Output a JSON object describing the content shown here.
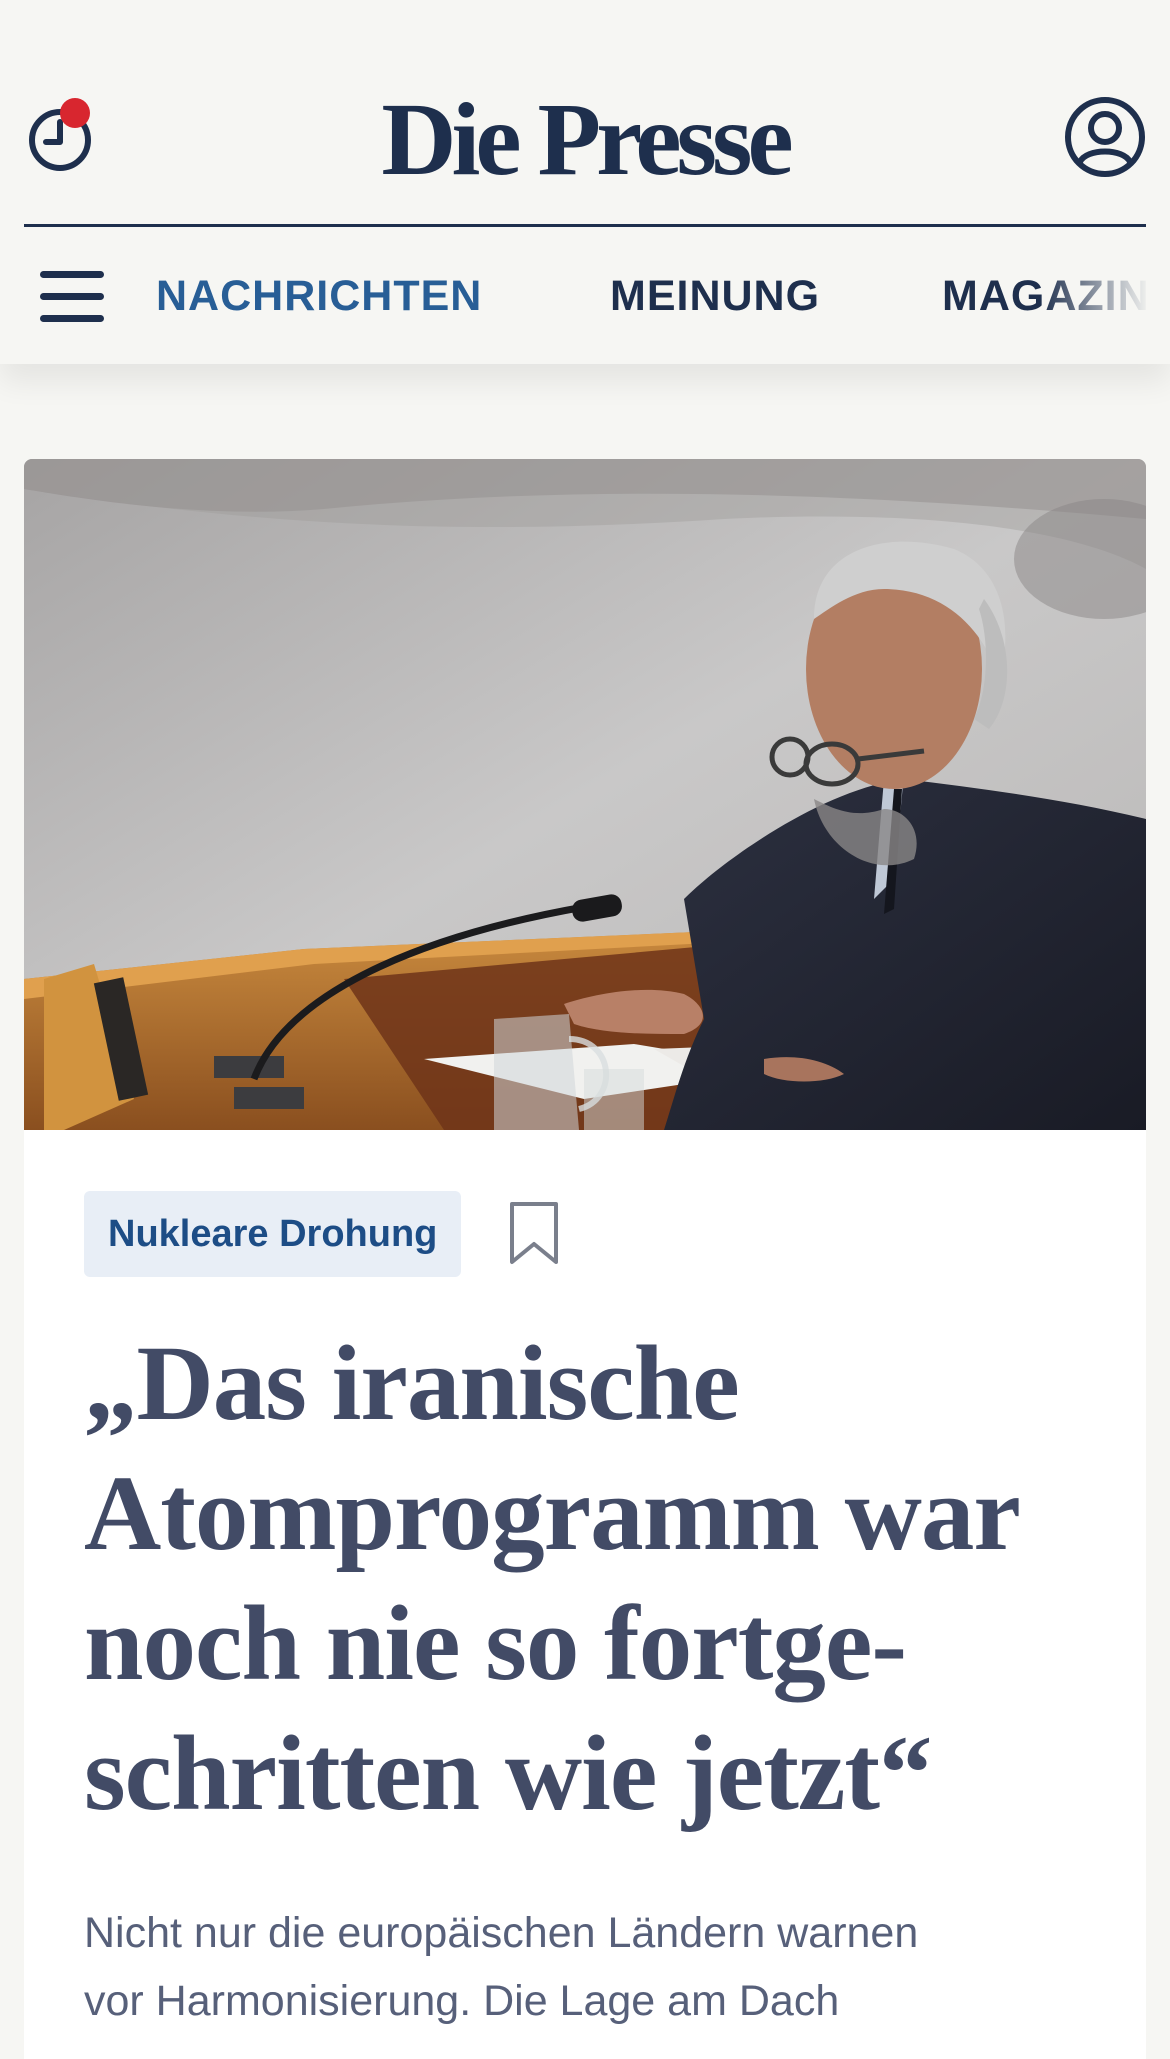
{
  "header": {
    "logo_text": "Die Presse",
    "history_icon": "history-clock-icon",
    "notification_badge_color": "#d8262f",
    "account_icon": "user-account-icon"
  },
  "nav": {
    "menu_icon": "hamburger-menu-icon",
    "items": [
      {
        "label": "NACHRICHTEN",
        "active": true
      },
      {
        "label": "MEINUNG",
        "active": false
      },
      {
        "label": "MAGAZIN",
        "active": false
      }
    ]
  },
  "article": {
    "image_alt": "Mann mit Brille spricht an einem Mikrofon im UN-Sicherheitsrat",
    "tag": "Nukleare Drohung",
    "bookmark_icon": "bookmark-icon",
    "headline_lines": [
      "„Das iranische",
      "Atomprogramm war",
      "noch nie so fortge-",
      "schritten wie jetzt“"
    ],
    "teaser_lines": [
      "Nicht nur die europäischen Ländern warnen",
      "vor Harmonisierung. Die Lage am Dach"
    ]
  },
  "colors": {
    "brand_navy": "#1e2f4d",
    "nav_active": "#285e96",
    "tag_bg": "#e8eef6",
    "headline": "#424b66"
  }
}
